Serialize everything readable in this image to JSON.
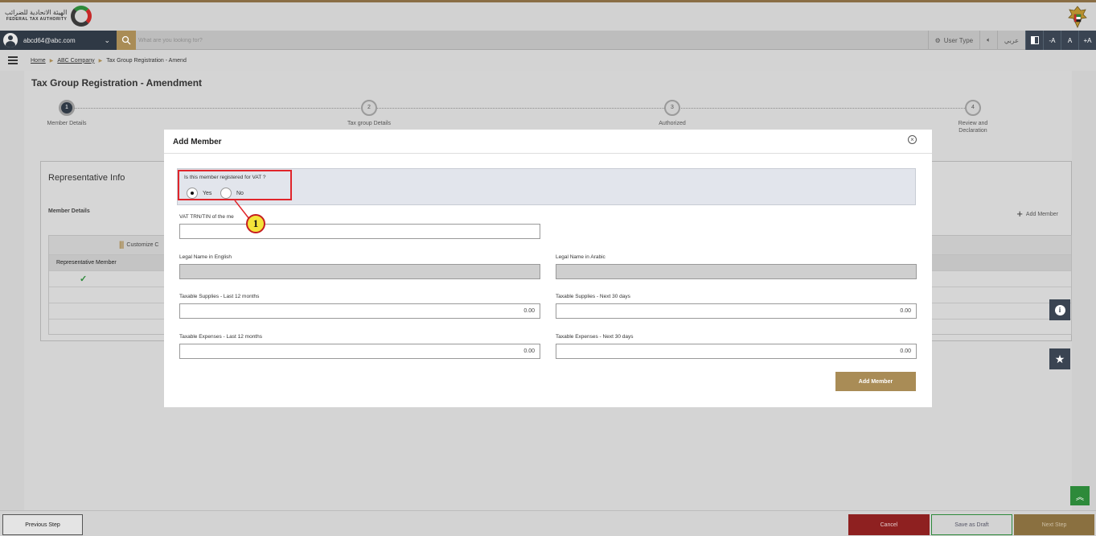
{
  "header": {
    "logo_arabic": "الهيئة الاتحادية للضرائب",
    "logo_english": "FEDERAL TAX AUTHORITY"
  },
  "utility": {
    "user_email": "abcd64@abc.com",
    "search_placeholder": "What are you looking for?",
    "user_type": "User Type",
    "arabic": "عربي",
    "font_minus": "-A",
    "font_normal": "A",
    "font_plus": "+A"
  },
  "breadcrumb": {
    "home": "Home",
    "company": "ABC Company",
    "current": "Tax Group Registration - Amend"
  },
  "page": {
    "title": "Tax Group Registration - Amendment",
    "steps": [
      {
        "number": "1",
        "label": "Member Details"
      },
      {
        "number": "2",
        "label": "Tax group Details"
      },
      {
        "number": "3",
        "label": "Authorized"
      },
      {
        "number": "4",
        "label": "Review and Declaration"
      }
    ],
    "rep_title": "Representative Info",
    "rep_subtitle": "Member Details",
    "add_member_link": "Add Member",
    "customize": "Customize C",
    "column_header": "Representative Member"
  },
  "modal": {
    "title": "Add Member",
    "vat_question": "Is this member registered for VAT ?",
    "radio_yes": "Yes",
    "radio_no": "No",
    "selected": "Yes",
    "trn_label": "VAT TRN/TIN of the me",
    "trn_value": "",
    "legal_en_label": "Legal Name in English",
    "legal_ar_label": "Legal Name in Arabic",
    "supplies_12_label": "Taxable Supplies - Last 12 months",
    "supplies_12_value": "0.00",
    "supplies_30_label": "Taxable Supplies - Next 30 days",
    "supplies_30_value": "0.00",
    "expenses_12_label": "Taxable Expenses - Last 12 months",
    "expenses_12_value": "0.00",
    "expenses_30_label": "Taxable Expenses - Next 30 days",
    "expenses_30_value": "0.00",
    "add_button": "Add Member",
    "callout_number": "1"
  },
  "footer": {
    "previous": "Previous Step",
    "cancel": "Cancel",
    "save_draft": "Save as Draft",
    "next": "Next Step"
  },
  "colors": {
    "gold": "#a98c56",
    "navy": "#2f3945",
    "highlight_red": "#e0252b",
    "callout_yellow": "#f4e33a"
  }
}
